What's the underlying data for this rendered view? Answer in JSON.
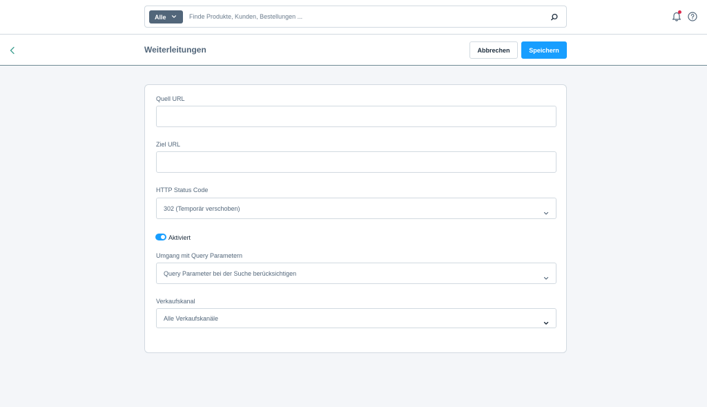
{
  "header": {
    "search": {
      "type_label": "Alle",
      "placeholder": "Finde Produkte, Kunden, Bestellungen ..."
    }
  },
  "smart_bar": {
    "title": "Weiterleitungen",
    "cancel_label": "Abbrechen",
    "save_label": "Speichern"
  },
  "form": {
    "source_url": {
      "label": "Quell URL",
      "value": ""
    },
    "target_url": {
      "label": "Ziel URL",
      "value": ""
    },
    "http_status": {
      "label": "HTTP Status Code",
      "value": "302 (Temporär verschoben)"
    },
    "active": {
      "label": "Aktiviert",
      "checked": true
    },
    "query_params": {
      "label": "Umgang mit Query Parametern",
      "value": "Query Parameter bei der Suche berücksichtigen"
    },
    "sales_channel": {
      "label": "Verkaufskanal",
      "value": "Alle Verkaufskanäle"
    }
  },
  "colors": {
    "primary": "#189eff",
    "text": "#52667a",
    "border": "#d1d9e0",
    "background": "#f4f6f9",
    "notification_dot": "#de294c"
  },
  "icons": [
    "search-icon",
    "bell-icon",
    "help-icon",
    "back-icon",
    "chevron-down-icon"
  ]
}
